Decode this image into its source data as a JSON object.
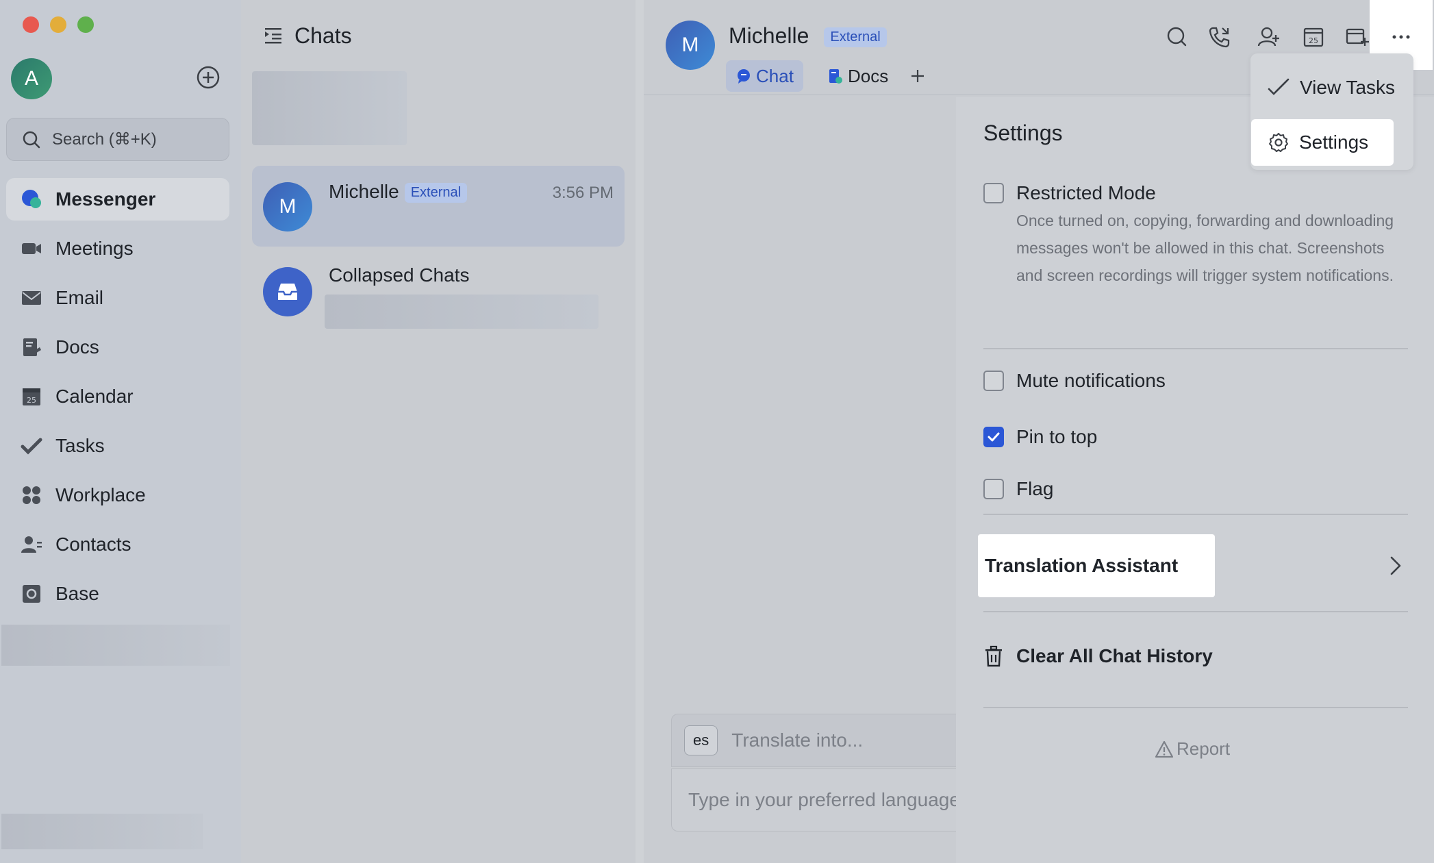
{
  "sidebar": {
    "avatar_letter": "A",
    "search_placeholder": "Search (⌘+K)",
    "nav": [
      {
        "label": "Messenger",
        "icon": "messenger-icon",
        "active": true
      },
      {
        "label": "Meetings",
        "icon": "video-camera-icon"
      },
      {
        "label": "Email",
        "icon": "envelope-icon"
      },
      {
        "label": "Docs",
        "icon": "docs-icon"
      },
      {
        "label": "Calendar",
        "icon": "calendar-icon"
      },
      {
        "label": "Tasks",
        "icon": "tasks-icon"
      },
      {
        "label": "Workplace",
        "icon": "grid-icon"
      },
      {
        "label": "Contacts",
        "icon": "contacts-icon"
      },
      {
        "label": "Base",
        "icon": "base-icon"
      }
    ]
  },
  "chatlist": {
    "title": "Chats",
    "items": [
      {
        "name": "Michelle",
        "badge": "External",
        "time": "3:56 PM",
        "avatar_letter": "M",
        "selected": true
      },
      {
        "name": "Collapsed Chats",
        "icon": "inbox-icon"
      }
    ]
  },
  "main": {
    "contact_name": "Michelle",
    "contact_badge": "External",
    "avatar_letter": "M",
    "tabs": [
      {
        "label": "Chat",
        "icon": "chat-icon",
        "active": true
      },
      {
        "label": "Docs",
        "icon": "docs-icon"
      }
    ],
    "header_icons": [
      "search-icon",
      "phone-icon",
      "add-member-icon",
      "calendar-icon",
      "add-event-icon",
      "more-icon"
    ],
    "translate_lang": "es",
    "translate_placeholder": "Translate into...",
    "compose_placeholder": "Type in your preferred language"
  },
  "settings": {
    "title": "Settings",
    "restricted_mode": {
      "label": "Restricted Mode",
      "checked": false,
      "description": "Once turned on, copying, forwarding and downloading messages won't be allowed in this chat. Screenshots and screen recordings will trigger system notifications."
    },
    "mute": {
      "label": "Mute notifications",
      "checked": false
    },
    "pin": {
      "label": "Pin to top",
      "checked": true
    },
    "flag": {
      "label": "Flag",
      "checked": false
    },
    "translation_assistant": "Translation Assistant",
    "clear_history": "Clear All Chat History",
    "report": "Report"
  },
  "dropdown": {
    "view_tasks": "View Tasks",
    "settings": "Settings"
  },
  "colors": {
    "accent": "#2b57d6",
    "badge_bg": "#b6c7ea",
    "badge_text": "#2a4fb8"
  }
}
